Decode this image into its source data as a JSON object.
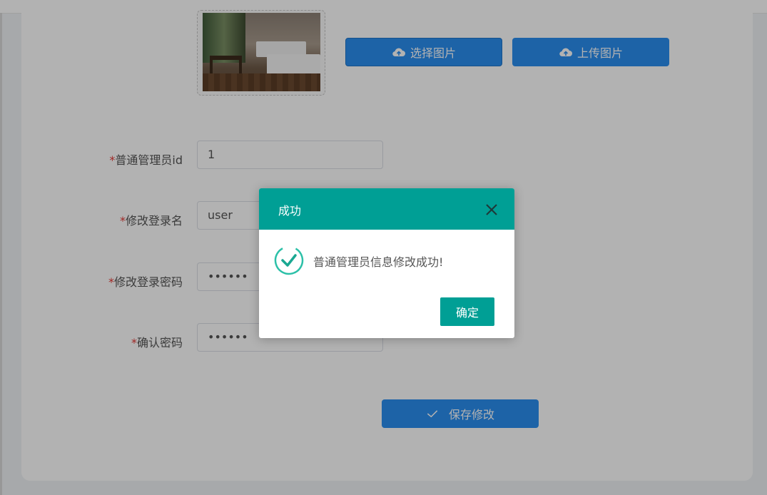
{
  "upload": {
    "select_label": "选择图片",
    "upload_label": "上传图片"
  },
  "form": {
    "required_mark": "*",
    "fields": [
      {
        "label": "普通管理员id",
        "value": "1"
      },
      {
        "label": "修改登录名",
        "value": "user"
      },
      {
        "label": "修改登录密码",
        "value": "••••••"
      },
      {
        "label": "确认密码",
        "value": "••••••"
      }
    ],
    "save_label": "保存修改"
  },
  "dialog": {
    "title": "成功",
    "message": "普通管理员信息修改成功!",
    "confirm_label": "确定"
  },
  "colors": {
    "primary_blue": "#2a8ef0",
    "dialog_teal": "#009f95",
    "required_red": "#e53935"
  },
  "icons": {
    "upload": "cloud-upload-icon",
    "save": "check-icon",
    "close": "close-icon",
    "success": "success-check-icon"
  }
}
